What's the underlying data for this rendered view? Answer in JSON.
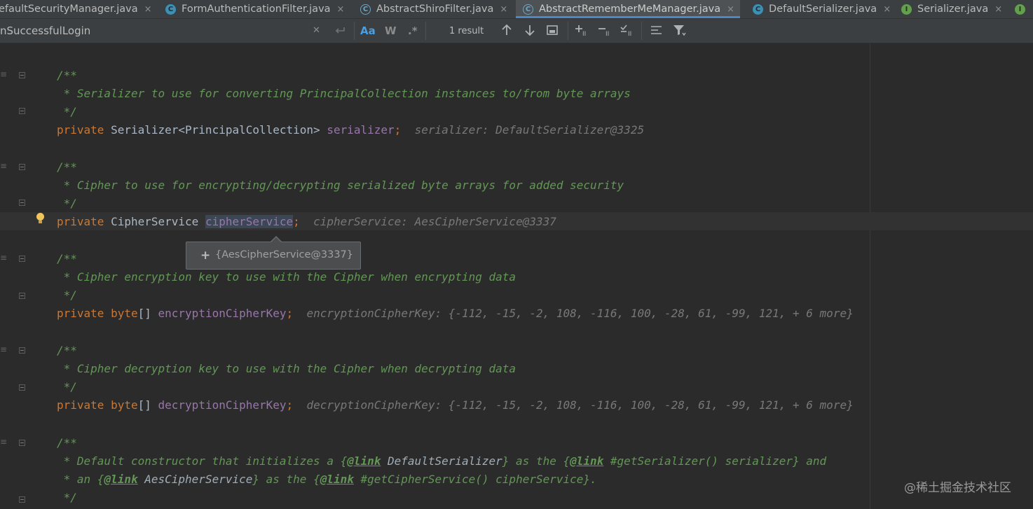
{
  "tabs": [
    {
      "label": "efaultSecurityManager.java",
      "icon": "none",
      "icon_letter": ""
    },
    {
      "label": "FormAuthenticationFilter.java",
      "icon": "class-icon",
      "icon_letter": "C"
    },
    {
      "label": "AbstractShiroFilter.java",
      "icon": "abstract-class-icon",
      "icon_letter": "C"
    },
    {
      "label": "AbstractRememberMeManager.java",
      "icon": "abstract-class-icon",
      "icon_letter": "C",
      "active": true
    },
    {
      "label": "DefaultSerializer.java",
      "icon": "class-icon",
      "icon_letter": "C"
    },
    {
      "label": "Serializer.java",
      "icon": "interface-icon",
      "icon_letter": "I"
    },
    {
      "label": "",
      "icon": "interface-icon",
      "icon_letter": "I"
    }
  ],
  "close_glyph": "×",
  "search": {
    "value": "nSuccessfulLogin",
    "clear": "✕",
    "match_case": "Aa",
    "words": "W",
    "regex": ".*",
    "result_count": "1 result"
  },
  "code": {
    "l1_doc_open": "/**",
    "l1_doc_text": " * Serializer to use for converting PrincipalCollection instances to/from byte arrays",
    "l1_doc_close": " */",
    "l1_kw": "private",
    "l1_type": " Serializer<PrincipalCollection> ",
    "l1_field": "serializer",
    "l1_semi": ";",
    "l1_hint": "serializer: DefaultSerializer@3325",
    "l2_doc_open": "/**",
    "l2_doc_text": " * Cipher to use for encrypting/decrypting serialized byte arrays for added security",
    "l2_doc_close": " */",
    "l2_kw": "private",
    "l2_type": " CipherService ",
    "l2_field": "cipherService",
    "l2_semi": ";",
    "l2_hint": "cipherService: AesCipherService@3337",
    "l3_doc_open": "/**",
    "l3_doc_text": " * Cipher encryption key to use with the Cipher when encrypting data",
    "l3_doc_close": " */",
    "l3_kw": "private",
    "l3_type_kw": " byte",
    "l3_type": "[] ",
    "l3_field": "encryptionCipherKey",
    "l3_semi": ";",
    "l3_hint": "encryptionCipherKey: {-112, -15, -2, 108, -116, 100, -28, 61, -99, 121, + 6 more}",
    "l4_doc_open": "/**",
    "l4_doc_text": " * Cipher decryption key to use with the Cipher when decrypting data",
    "l4_doc_close": " */",
    "l4_kw": "private",
    "l4_type_kw": " byte",
    "l4_type": "[] ",
    "l4_field": "decryptionCipherKey",
    "l4_semi": ";",
    "l4_hint": "decryptionCipherKey: {-112, -15, -2, 108, -116, 100, -28, 61, -99, 121, + 6 more}",
    "l5_doc_open": "/**",
    "l5_a1": " * Default constructor that initializes a {",
    "l5_link1": "@link",
    "l5_ref1": " DefaultSerializer",
    "l5_a2": "} as the {",
    "l5_link2": "@link",
    "l5_a3": " #getSerializer() serializer} and",
    "l5_b1": " * an {",
    "l5_link3": "@link",
    "l5_ref2": " AesCipherService",
    "l5_b2": "} as the {",
    "l5_link4": "@link",
    "l5_b3": " #getCipherService() cipherService}.",
    "l5_doc_close": " */"
  },
  "popup_value": "{AesCipherService@3337}",
  "popup_plus": "+",
  "watermark": "@稀土掘金技术社区",
  "colors": {
    "background": "#2b2b2b",
    "keyword": "#cc7832",
    "field": "#9876aa",
    "doc_comment": "#629755",
    "inline_hint": "#787878",
    "accent": "#4a88c7"
  }
}
